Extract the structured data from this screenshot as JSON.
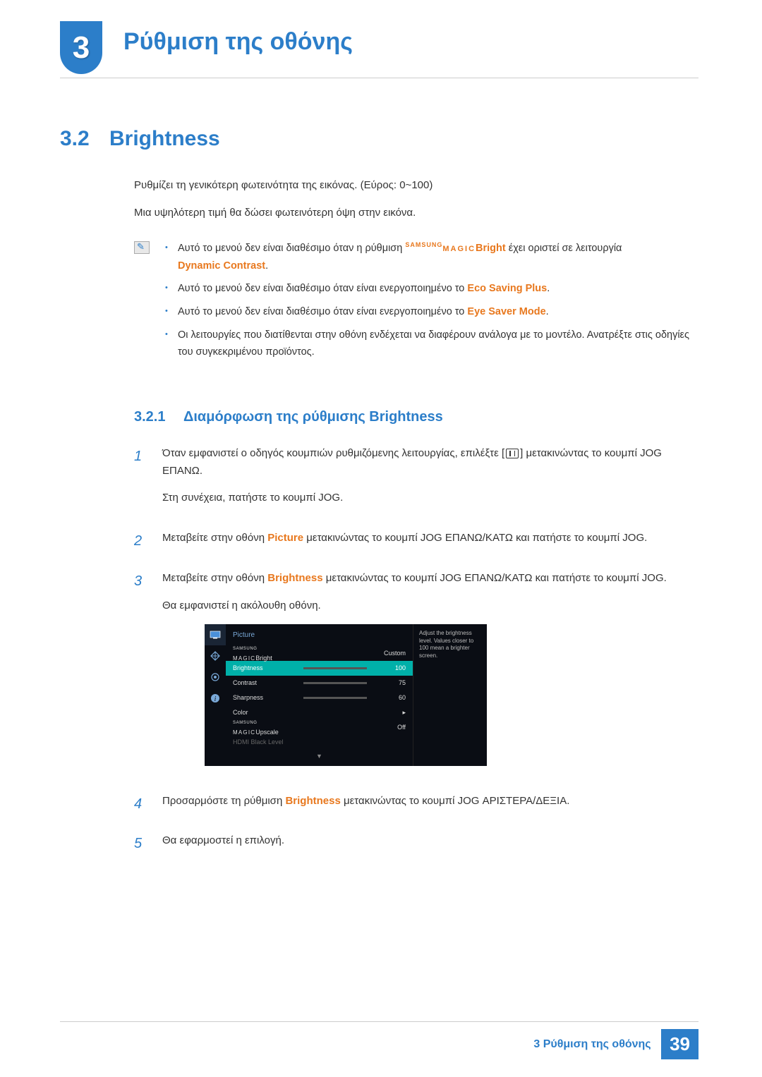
{
  "chapter": {
    "number": "3",
    "title": "Ρύθμιση της οθόνης"
  },
  "section": {
    "number": "3.2",
    "title": "Brightness"
  },
  "intro": {
    "line1": "Ρυθμίζει τη γενικότερη φωτεινότητα της εικόνας. (Εύρος: 0~100)",
    "line2": "Μια υψηλότερη τιμή θα δώσει φωτεινότερη όψη στην εικόνα."
  },
  "notes": {
    "n1a": "Αυτό το μενού δεν είναι διαθέσιμο όταν η ρύθμιση ",
    "n1_magic_top": "SAMSUNG",
    "n1_magic_bot": "MAGIC",
    "n1_bright": "Bright",
    "n1b": " έχει οριστεί σε λειτουργία ",
    "n1_dc": "Dynamic Contrast",
    "n2a": "Αυτό το μενού δεν είναι διαθέσιμο όταν είναι ενεργοποιημένο το ",
    "n2_eco": "Eco Saving Plus",
    "n3a": "Αυτό το μενού δεν είναι διαθέσιμο όταν είναι ενεργοποιημένο το ",
    "n3_eye": "Eye Saver Mode",
    "n4": "Οι λειτουργίες που διατίθενται στην οθόνη ενδέχεται να διαφέρουν ανάλογα με το μοντέλο. Ανατρέξτε στις οδηγίες του συγκεκριμένου προϊόντος."
  },
  "subsection": {
    "number": "3.2.1",
    "title": "Διαμόρφωση της ρύθμισης Brightness"
  },
  "steps": {
    "s1": {
      "num": "1",
      "p1a": "Όταν εμφανιστεί ο οδηγός κουμπιών ρυθμιζόμενης λειτουργίας, επιλέξτε [",
      "p1b": "] μετακινώντας το κουμπί JOG ΕΠΑΝΩ.",
      "p2": "Στη συνέχεια, πατήστε το κουμπί JOG."
    },
    "s2": {
      "num": "2",
      "a": "Μεταβείτε στην οθόνη ",
      "pic": "Picture",
      "b": " μετακινώντας το κουμπί JOG ΕΠΑΝΩ/ΚΑΤΩ και πατήστε το κουμπί JOG."
    },
    "s3": {
      "num": "3",
      "a": "Μεταβείτε στην οθόνη ",
      "br": "Brightness",
      "b": " μετακινώντας το κουμπί JOG ΕΠΑΝΩ/ΚΑΤΩ και πατήστε το κουμπί JOG.",
      "p2": "Θα εμφανιστεί η ακόλουθη οθόνη."
    },
    "s4": {
      "num": "4",
      "a": "Προσαρμόστε τη ρύθμιση ",
      "br": "Brightness",
      "b": " μετακινώντας το κουμπί JOG ΑΡΙΣΤΕΡΑ/ΔΕΞΙΑ."
    },
    "s5": {
      "num": "5",
      "a": "Θα εφαρμοστεί η επιλογή."
    }
  },
  "osd": {
    "title": "Picture",
    "help": "Adjust the brightness level. Values closer to 100 mean a brighter screen.",
    "rows": {
      "magicbright": {
        "label": "Bright",
        "value": "Custom"
      },
      "brightness": {
        "label": "Brightness",
        "value": "100",
        "fill": 100
      },
      "contrast": {
        "label": "Contrast",
        "value": "75",
        "fill": 75
      },
      "sharpness": {
        "label": "Sharpness",
        "value": "60",
        "fill": 60
      },
      "color": {
        "label": "Color",
        "value": "▸"
      },
      "upscale": {
        "label": "Upscale",
        "value": "Off"
      },
      "hdmi": {
        "label": "HDMI Black Level"
      }
    },
    "magic_top": "SAMSUNG",
    "magic_bot": "MAGIC"
  },
  "footer": {
    "text": "3 Ρύθμιση της οθόνης",
    "page": "39"
  }
}
